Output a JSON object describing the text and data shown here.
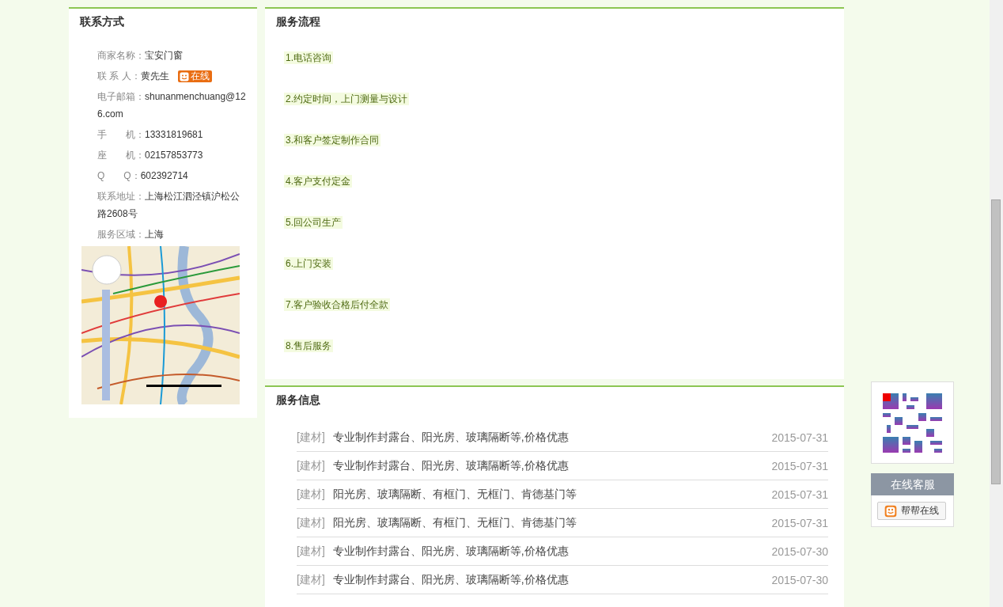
{
  "contact": {
    "title": "联系方式",
    "fields": [
      {
        "label": "商家名称：",
        "value": "宝安门窗"
      },
      {
        "label": "联 系 人：",
        "value": "黄先生",
        "badge": "在线"
      },
      {
        "label": "电子邮箱：",
        "value": "shunanmenchuang@126.com"
      },
      {
        "label": "手　　机：",
        "value": "13331819681"
      },
      {
        "label": "座　　机：",
        "value": "02157853773"
      },
      {
        "label": "Q　　Q：",
        "value": "602392714"
      },
      {
        "label": "联系地址：",
        "value": "上海松江泗泾镇沪松公路2608号"
      },
      {
        "label": "服务区域：",
        "value": "上海"
      }
    ]
  },
  "process": {
    "title": "服务流程",
    "steps": [
      "1.电话咨询",
      "2.约定时间，上门测量与设计",
      "3.和客户签定制作合同",
      "4.客户支付定金",
      "5.回公司生产",
      "6.上门安装",
      "7.客户验收合格后付全款",
      "8.售后服务"
    ]
  },
  "info": {
    "title": "服务信息",
    "rows": [
      {
        "tag": "[建材]",
        "title": "专业制作封露台、阳光房、玻璃隔断等,价格优惠",
        "date": "2015-07-31"
      },
      {
        "tag": "[建材]",
        "title": "专业制作封露台、阳光房、玻璃隔断等,价格优惠",
        "date": "2015-07-31"
      },
      {
        "tag": "[建材]",
        "title": "阳光房、玻璃隔断、有框门、无框门、肯德基门等",
        "date": "2015-07-31"
      },
      {
        "tag": "[建材]",
        "title": "阳光房、玻璃隔断、有框门、无框门、肯德基门等",
        "date": "2015-07-31"
      },
      {
        "tag": "[建材]",
        "title": "专业制作封露台、阳光房、玻璃隔断等,价格优惠",
        "date": "2015-07-30"
      },
      {
        "tag": "[建材]",
        "title": "专业制作封露台、阳光房、玻璃隔断等,价格优惠",
        "date": "2015-07-30"
      }
    ]
  },
  "service": {
    "title": "在线客服",
    "button": "帮帮在线"
  }
}
